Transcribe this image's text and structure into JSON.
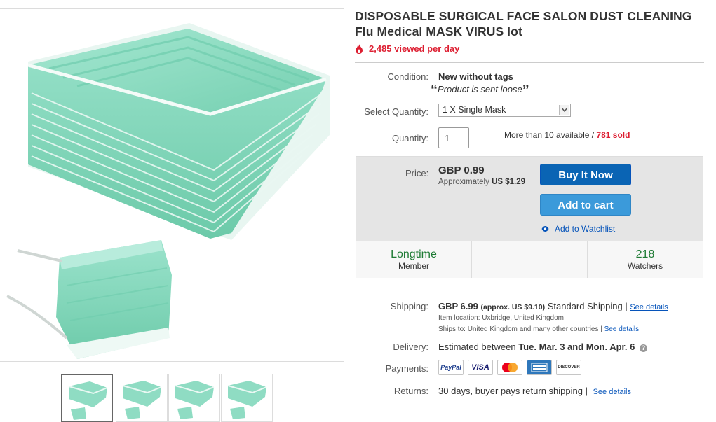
{
  "listing": {
    "title": "DISPOSABLE SURGICAL FACE SALON DUST CLEANING Flu Medical MASK VIRUS lot",
    "views": "2,485 viewed per day"
  },
  "details": {
    "condition_label": "Condition:",
    "condition_value": "New without tags",
    "condition_note": "Product is sent loose",
    "select_quantity_label": "Select Quantity:",
    "select_quantity_value": "1 X Single Mask",
    "quantity_label": "Quantity:",
    "quantity_value": "1",
    "availability_text": "More than 10 available / ",
    "sold_text": "781 sold"
  },
  "buybox": {
    "price_label": "Price:",
    "price": "GBP 0.99",
    "approx_prefix": "Approximately",
    "approx_value": "US $1.29",
    "buy_now_label": "Buy It Now",
    "add_to_cart_label": "Add to cart",
    "watchlist_label": "Add to Watchlist",
    "stats": [
      {
        "big": "Longtime",
        "small": "Member"
      },
      {
        "big": "",
        "small": ""
      },
      {
        "big": "218",
        "small": "Watchers"
      }
    ]
  },
  "shipping": {
    "label": "Shipping:",
    "cost": "GBP 6.99",
    "approx": "(approx. US $9.10)",
    "service": "Standard Shipping |",
    "see_details": "See details",
    "item_location_label": "Item location:",
    "item_location": "Uxbridge, United Kingdom",
    "ships_to_label": "Ships to:",
    "ships_to": "United Kingdom and many other countries |",
    "ships_to_see_details": "See details"
  },
  "delivery": {
    "label": "Delivery:",
    "prefix": "Estimated between",
    "range": "Tue. Mar. 3 and Mon. Apr. 6"
  },
  "payments": {
    "label": "Payments:",
    "methods": [
      "PayPal",
      "VISA",
      "MasterCard",
      "AMERICAN EXPRESS",
      "DISCOVER"
    ]
  },
  "returns": {
    "label": "Returns:",
    "text": "30 days, buyer pays return shipping |",
    "see_details": "See details"
  },
  "colors": {
    "mask_green": "#8fdcc3",
    "mask_shadow": "#66c6a6",
    "alert_red": "#dd1e31",
    "primary_blue": "#0a64b4",
    "secondary_blue": "#3b9ada",
    "positive_green": "#1e7b34"
  }
}
